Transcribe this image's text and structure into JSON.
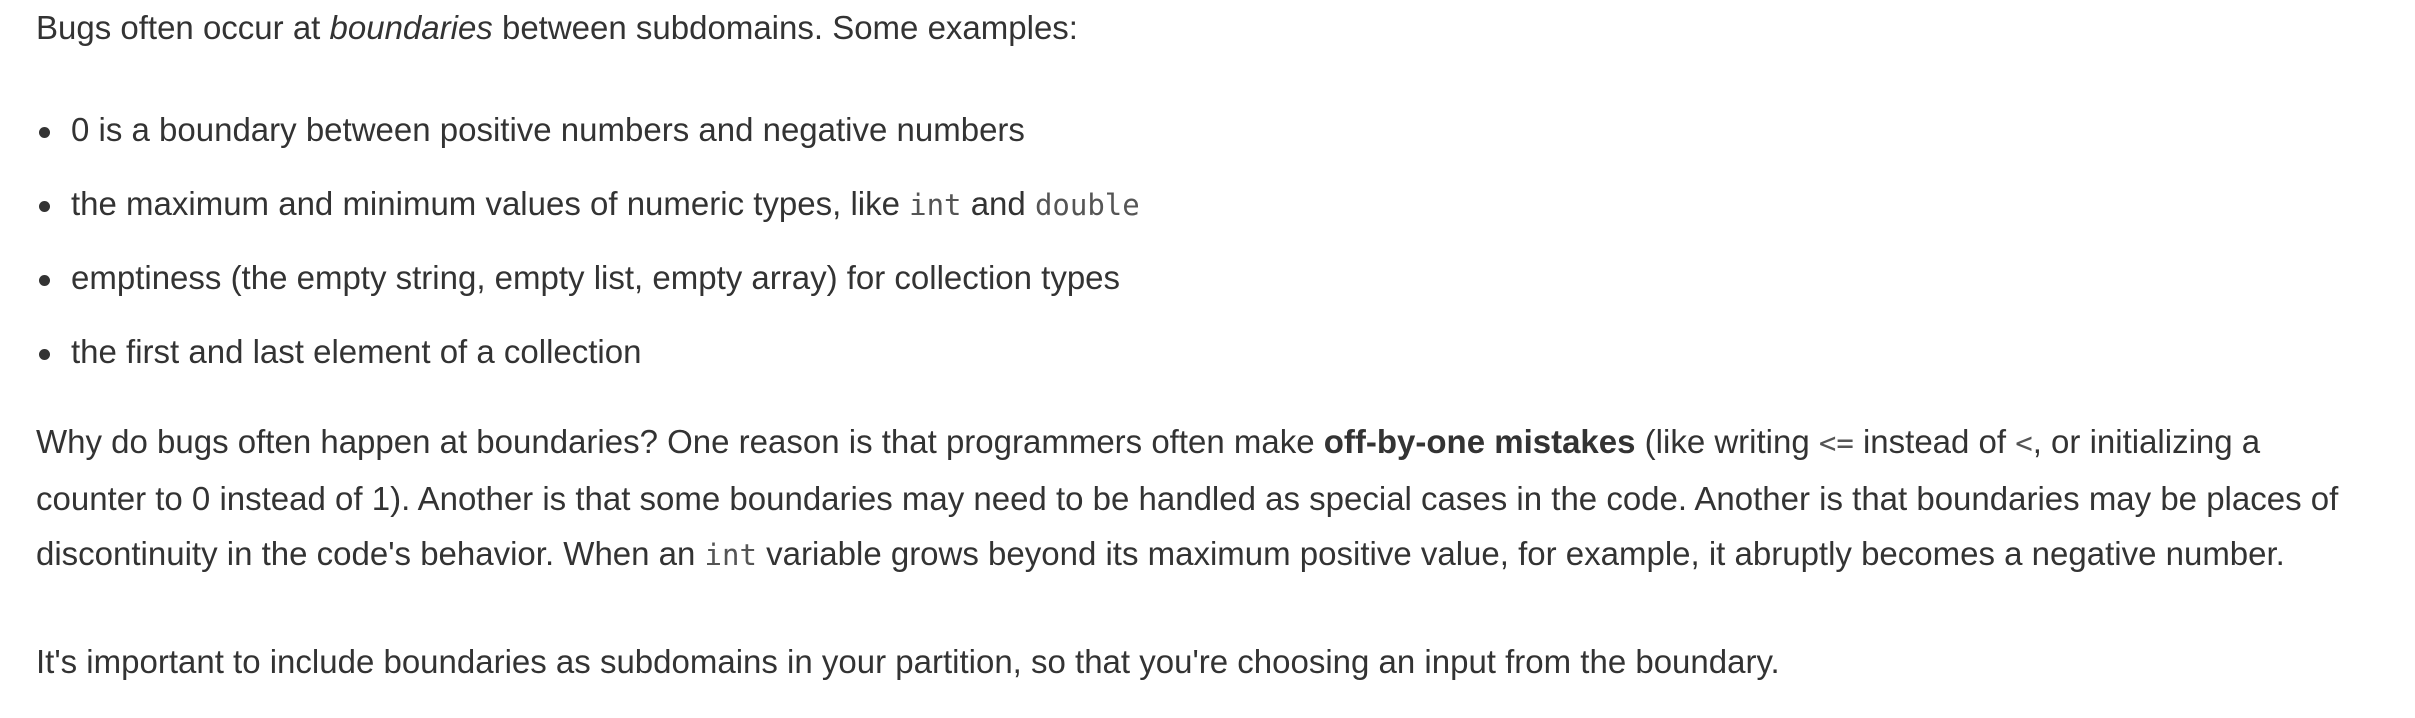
{
  "intro": {
    "before": "Bugs often occur at ",
    "emph": "boundaries",
    "after": " between subdomains. Some examples:"
  },
  "examples": [
    {
      "text": "0 is a boundary between positive numbers and negative numbers"
    },
    {
      "before": "the maximum and minimum values of numeric types, like ",
      "code1": "int",
      "mid": " and ",
      "code2": "double"
    },
    {
      "text": "emptiness (the empty string, empty list, empty array) for collection types"
    },
    {
      "text": "the first and last element of a collection"
    }
  ],
  "why": {
    "t1": "Why do bugs often happen at boundaries? One reason is that programmers often make ",
    "bold": "off-by-one mistakes",
    "t2": " (like writing ",
    "code_le": "<=",
    "t3": " instead of ",
    "code_lt": "<",
    "t4": ", or initializing a counter to 0 instead of 1). Another is that some boundaries may need to be handled as special cases in the code. Another is that boundaries may be places of discontinuity in the code's behavior. When an ",
    "code_int": "int",
    "t5": " variable grows beyond its maximum positive value, for example, it abruptly becomes a negative number."
  },
  "important": "It's important to include boundaries as subdomains in your partition, so that you're choosing an input from the boundary."
}
